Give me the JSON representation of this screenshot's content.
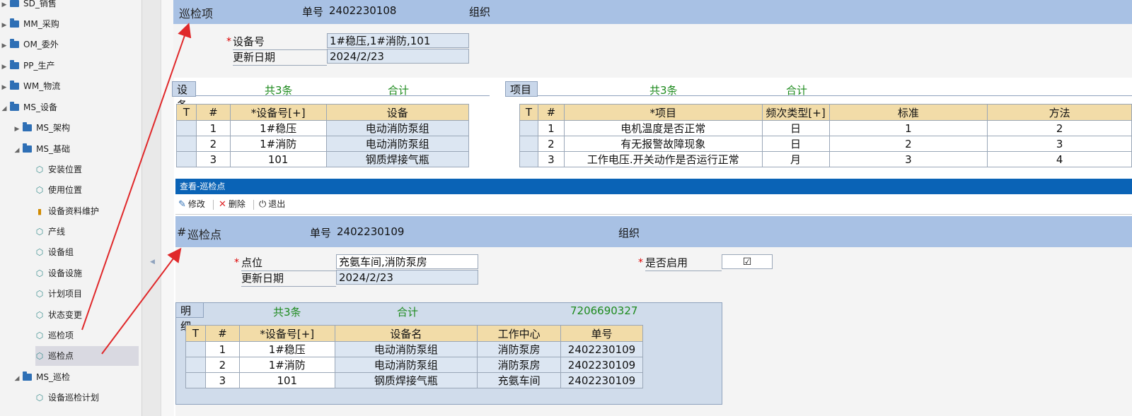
{
  "sidebar": {
    "items": [
      {
        "label": "SD_销售",
        "kind": "folder",
        "expanded": false
      },
      {
        "label": "MM_采购",
        "kind": "folder",
        "expanded": false
      },
      {
        "label": "OM_委外",
        "kind": "folder",
        "expanded": false
      },
      {
        "label": "PP_生产",
        "kind": "folder",
        "expanded": false
      },
      {
        "label": "WM_物流",
        "kind": "folder",
        "expanded": false
      },
      {
        "label": "MS_设备",
        "kind": "folder",
        "expanded": true
      },
      {
        "label": "MS_架构",
        "kind": "folder",
        "expanded": false
      },
      {
        "label": "MS_基础",
        "kind": "folder",
        "expanded": true
      },
      {
        "label": "安装位置",
        "kind": "leaf"
      },
      {
        "label": "使用位置",
        "kind": "leaf"
      },
      {
        "label": "设备资料维护",
        "kind": "chart"
      },
      {
        "label": "产线",
        "kind": "leaf"
      },
      {
        "label": "设备组",
        "kind": "leaf"
      },
      {
        "label": "设备设施",
        "kind": "leaf"
      },
      {
        "label": "计划项目",
        "kind": "leaf"
      },
      {
        "label": "状态变更",
        "kind": "leaf"
      },
      {
        "label": "巡检项",
        "kind": "leaf"
      },
      {
        "label": "巡检点",
        "kind": "leaf",
        "selected": true
      },
      {
        "label": "MS_巡检",
        "kind": "folder",
        "expanded": true
      },
      {
        "label": "设备巡检计划",
        "kind": "leaf"
      }
    ]
  },
  "form1": {
    "title": "巡检项",
    "docno_label": "单号",
    "docno": "2402230108",
    "org_label": "组织",
    "equip_label": "设备号",
    "equip_value": "1#稳压,1#消防,101",
    "date_label": "更新日期",
    "date_value": "2024/2/23",
    "equip_tab": "设备",
    "equip_count": "共3条",
    "equip_total": "合计",
    "equip_headers": [
      "T",
      "#",
      "*设备号[+]",
      "设备"
    ],
    "equip_rows": [
      {
        "n": "1",
        "code": "1#稳压",
        "name": "电动消防泵组"
      },
      {
        "n": "2",
        "code": "1#消防",
        "name": "电动消防泵组"
      },
      {
        "n": "3",
        "code": "101",
        "name": "钢质焊接气瓶"
      }
    ],
    "item_tab": "项目",
    "item_count": "共3条",
    "item_total": "合计",
    "item_headers": [
      "T",
      "#",
      "*项目",
      "频次类型[+]",
      "标准",
      "方法"
    ],
    "item_rows": [
      {
        "n": "1",
        "item": "电机温度是否正常",
        "freq": "日",
        "std": "1",
        "method": "2"
      },
      {
        "n": "2",
        "item": "有无报警故障现象",
        "freq": "日",
        "std": "2",
        "method": "3"
      },
      {
        "n": "3",
        "item": "工作电压.开关动作是否运行正常",
        "freq": "月",
        "std": "3",
        "method": "4"
      }
    ]
  },
  "window2": {
    "title": "查看-巡检点",
    "edit_label": "修改",
    "delete_label": "删除",
    "exit_label": "退出"
  },
  "form2": {
    "hash": "#",
    "title": "巡检点",
    "docno_label": "单号",
    "docno": "2402230109",
    "org_label": "组织",
    "point_label": "点位",
    "point_value": "充氨车间,消防泵房",
    "date_label": "更新日期",
    "date_value": "2024/2/23",
    "enabled_label": "是否启用",
    "enabled_mark": "☑",
    "detail_tab": "明细",
    "detail_count": "共3条",
    "detail_total": "合计",
    "detail_sum": "7206690327",
    "detail_headers": [
      "T",
      "#",
      "*设备号[+]",
      "设备名",
      "工作中心",
      "单号"
    ],
    "detail_rows": [
      {
        "n": "1",
        "code": "1#稳压",
        "name": "电动消防泵组",
        "wc": "消防泵房",
        "no": "2402230109"
      },
      {
        "n": "2",
        "code": "1#消防",
        "name": "电动消防泵组",
        "wc": "消防泵房",
        "no": "2402230109"
      },
      {
        "n": "3",
        "code": "101",
        "name": "钢质焊接气瓶",
        "wc": "充氨车间",
        "no": "2402230109"
      }
    ]
  },
  "colors": {
    "accent_arrow": "#e0282a",
    "title_bar": "#a8c1e4",
    "window_bar": "#0a63b6"
  }
}
